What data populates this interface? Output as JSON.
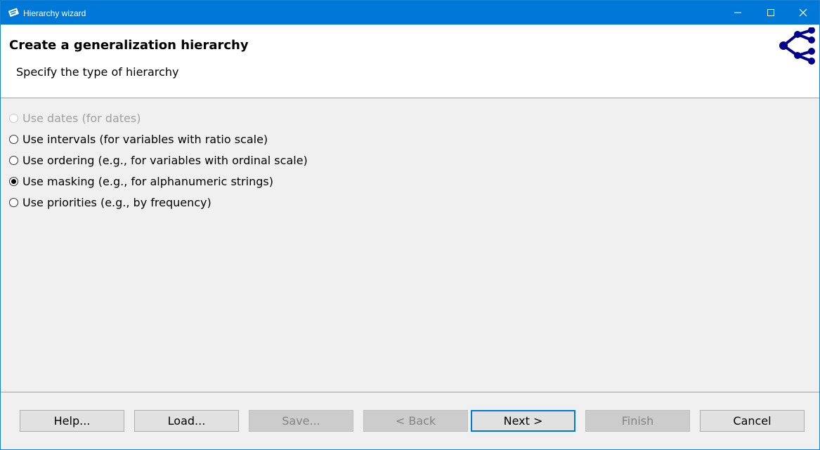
{
  "window": {
    "title": "Hierarchy wizard",
    "accent_color": "#0078d7",
    "controls": [
      "minimize-icon",
      "maximize-icon",
      "close-icon"
    ]
  },
  "header": {
    "title": "Create a generalization hierarchy",
    "subtitle": "Specify the type of hierarchy",
    "graphic_icon": "hierarchy-tree-icon",
    "graphic_color": "#00008b"
  },
  "options": [
    {
      "label": "Use dates (for dates)",
      "selected": false,
      "enabled": false
    },
    {
      "label": "Use intervals (for variables with ratio scale)",
      "selected": false,
      "enabled": true
    },
    {
      "label": "Use ordering (e.g., for variables with ordinal scale)",
      "selected": false,
      "enabled": true
    },
    {
      "label": "Use masking (e.g., for alphanumeric strings)",
      "selected": true,
      "enabled": true
    },
    {
      "label": "Use priorities (e.g., by frequency)",
      "selected": false,
      "enabled": true
    }
  ],
  "buttons": {
    "help": "Help...",
    "load": "Load...",
    "save": "Save...",
    "back": "< Back",
    "next": "Next >",
    "finish": "Finish",
    "cancel": "Cancel"
  }
}
